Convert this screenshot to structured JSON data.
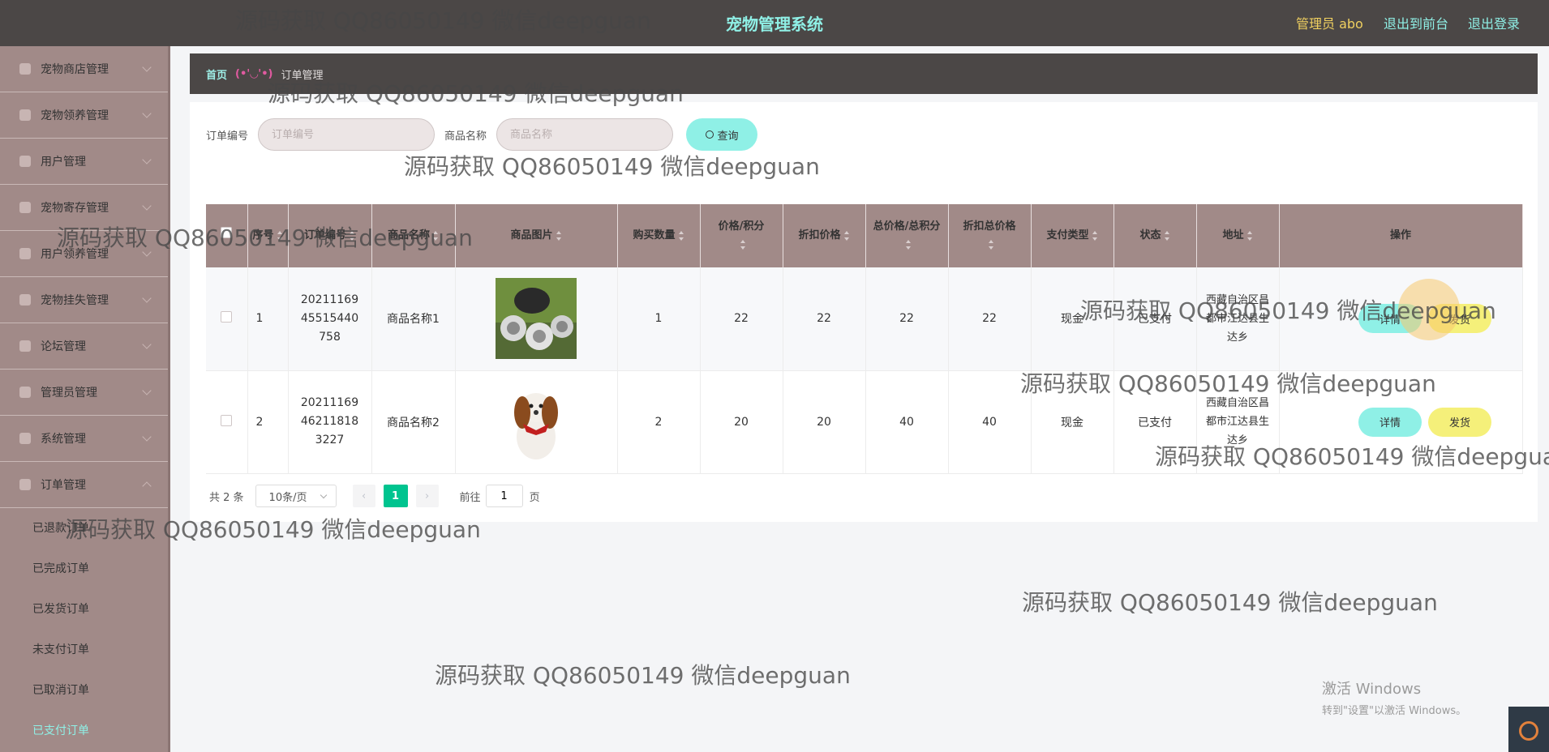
{
  "header": {
    "title": "宠物管理系统",
    "admin": "管理员 abo",
    "front_link": "退出到前台",
    "logout_link": "退出登录"
  },
  "sidebar": {
    "items": [
      {
        "label": "宠物商店管理"
      },
      {
        "label": "宠物领养管理"
      },
      {
        "label": "用户管理"
      },
      {
        "label": "宠物寄存管理"
      },
      {
        "label": "用户领养管理"
      },
      {
        "label": "宠物挂失管理"
      },
      {
        "label": "论坛管理"
      },
      {
        "label": "管理员管理"
      },
      {
        "label": "系统管理"
      },
      {
        "label": "订单管理"
      }
    ],
    "submenu": [
      {
        "label": "已退款订单"
      },
      {
        "label": "已完成订单"
      },
      {
        "label": "已发货订单"
      },
      {
        "label": "未支付订单"
      },
      {
        "label": "已取消订单"
      },
      {
        "label": "已支付订单"
      }
    ]
  },
  "breadcrumb": {
    "home": "首页",
    "face": "(•'◡'•)",
    "current": "订单管理"
  },
  "search": {
    "order_label": "订单编号",
    "order_placeholder": "订单编号",
    "product_label": "商品名称",
    "product_placeholder": "商品名称",
    "query_button": "查询"
  },
  "table": {
    "headers": [
      "序号",
      "订单编号",
      "商品名称",
      "商品图片",
      "购买数量",
      "价格/积分",
      "折扣价格",
      "总价格/总积分",
      "折扣总价格",
      "支付类型",
      "状态",
      "地址",
      "操作"
    ],
    "rows": [
      {
        "index": "1",
        "order_no": "2021116945515440758",
        "product": "商品名称1",
        "quantity": "1",
        "price": "22",
        "discount_price": "22",
        "total": "22",
        "discount_total": "22",
        "pay_type": "现金",
        "status": "已支付",
        "address": "西藏自治区昌都市江达县生达乡",
        "detail_button": "详情",
        "ship_button": "发货"
      },
      {
        "index": "2",
        "order_no": "20211169462118183227",
        "product": "商品名称2",
        "quantity": "2",
        "price": "20",
        "discount_price": "20",
        "total": "40",
        "discount_total": "40",
        "pay_type": "现金",
        "status": "已支付",
        "address": "西藏自治区昌都市江达县生达乡",
        "detail_button": "详情",
        "ship_button": "发货"
      }
    ]
  },
  "pagination": {
    "total": "共 2 条",
    "page_size": "10条/页",
    "current_page": "1",
    "goto_label": "前往",
    "goto_value": "1",
    "page_suffix": "页"
  },
  "watermark": "源码获取 QQ86050149 微信deepguan",
  "windows": {
    "line1": "激活 Windows",
    "line2": "转到\"设置\"以激活 Windows。"
  },
  "colors": {
    "topbar": "#4b4746",
    "accent": "#8ff0e6",
    "sidebar": "#a18a88",
    "ship_button": "#f5f07a",
    "page_active": "#00c48f"
  }
}
